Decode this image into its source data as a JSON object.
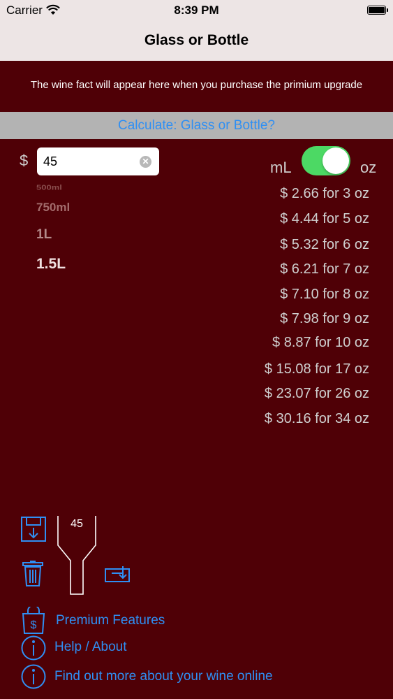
{
  "status_bar": {
    "carrier": "Carrier",
    "time": "8:39 PM"
  },
  "nav": {
    "title": "Glass or Bottle"
  },
  "wine_fact": "The wine fact will appear here when you purchase the primium upgrade",
  "calc_button": "Calculate: Glass or Bottle?",
  "price": {
    "currency": "$",
    "value": "45"
  },
  "units": {
    "left": "mL",
    "right": "oz",
    "toggle_on": true
  },
  "bottle_sizes": [
    "500ml",
    "750ml",
    "1L",
    "1.5L"
  ],
  "bottle_selected": "1.5L",
  "results": [
    "$ 2.66 for 3 oz",
    "$ 4.44 for 5 oz",
    "$ 5.32 for 6 oz",
    "$ 6.21 for 7 oz",
    "$ 7.10 for 8 oz",
    "$ 7.98 for 9 oz",
    "$ 8.87 for 10 oz",
    "$ 15.08 for 17 oz",
    "$ 23.07 for 26 oz",
    "$ 30.16 for 34 oz"
  ],
  "bottle_graphic_value": "45",
  "icons": {
    "save": "save-icon",
    "trash": "trash-icon",
    "load": "load-icon",
    "premium": "shopping-bag-dollar-icon",
    "help": "info-icon",
    "online": "info-icon"
  },
  "links": {
    "premium": "Premium Features",
    "help": "Help / About",
    "online": "Find out more about your wine online"
  },
  "colors": {
    "background": "#4f0006",
    "bar": "#ede5e5",
    "accent": "#2f8ff3",
    "toggle": "#4cd964",
    "calc_bar": "#b3b3b3"
  }
}
